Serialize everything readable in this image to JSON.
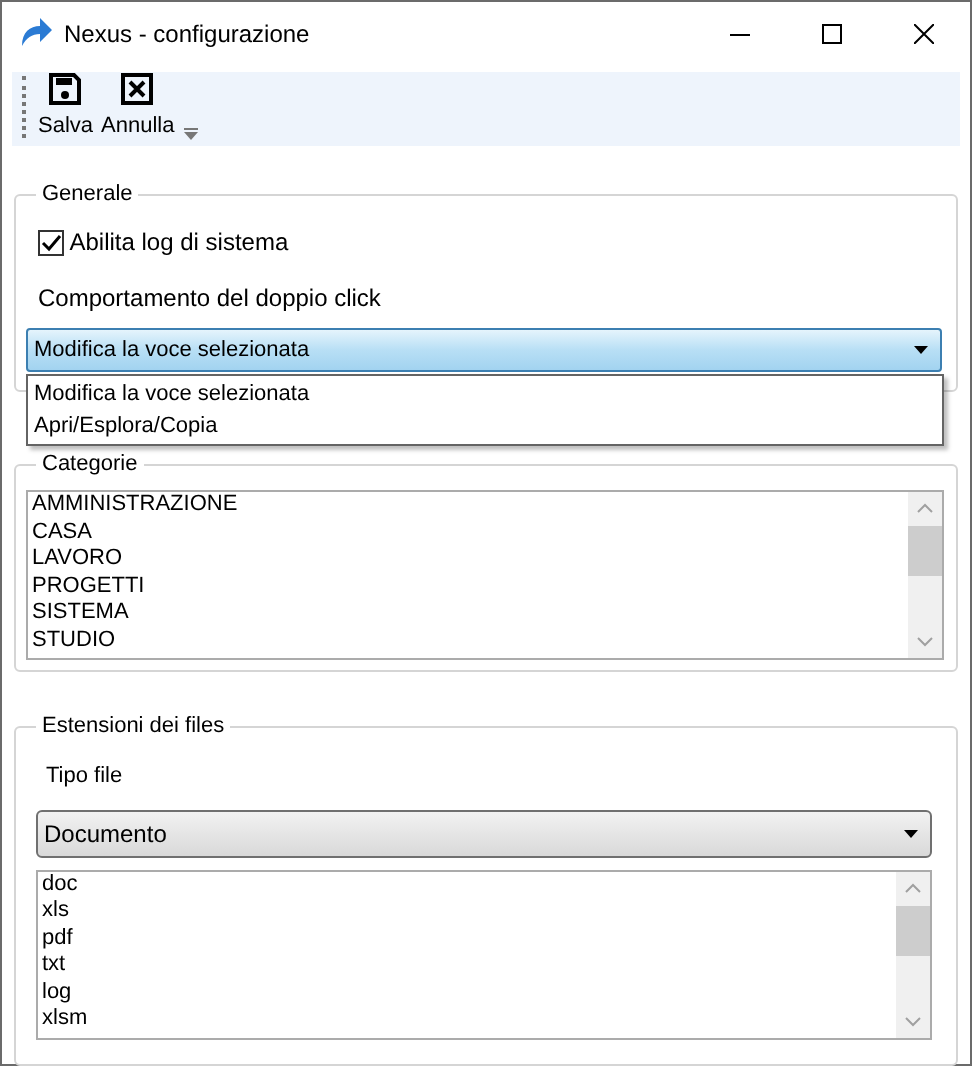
{
  "window": {
    "title": "Nexus - configurazione"
  },
  "toolbar": {
    "buttons": [
      {
        "kind": "save",
        "label": "Salva"
      },
      {
        "kind": "cancel",
        "label": "Annulla"
      }
    ]
  },
  "general": {
    "title": "Generale",
    "log_checkbox": {
      "label": "Abilita log di sistema",
      "checked": true
    },
    "double_click": {
      "label": "Comportamento del doppio click",
      "value": "Modifica la voce selezionata",
      "expanded": true,
      "options": [
        "Modifica la voce selezionata",
        "Apri/Esplora/Copia"
      ]
    }
  },
  "categories": {
    "title": "Categorie",
    "items": [
      "AMMINISTRAZIONE",
      "CASA",
      "LAVORO",
      "PROGETTI",
      "SISTEMA",
      "STUDIO"
    ]
  },
  "extensions": {
    "title": "Estensioni dei files",
    "file_type": {
      "label": "Tipo file",
      "value": "Documento"
    },
    "items": [
      "doc",
      "xls",
      "pdf",
      "txt",
      "log",
      "xlsm"
    ]
  }
}
